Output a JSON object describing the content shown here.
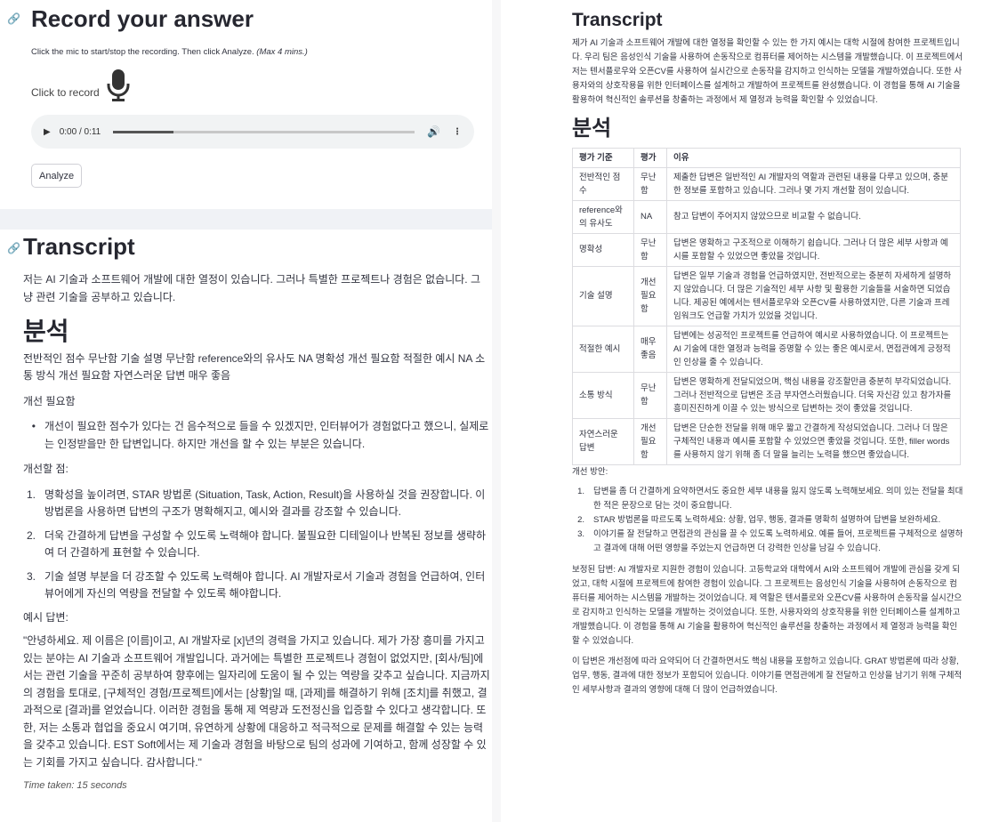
{
  "record": {
    "title": "Record your answer",
    "instructions": "Click the mic to start/stop the recording. Then click Analyze.",
    "max_note": "(Max 4 mins.)",
    "click_to_record": "Click to record",
    "audio_time": "0:00 / 0:11",
    "audio_progress": 0.2,
    "analyze_label": "Analyze"
  },
  "left": {
    "transcript_title": "Transcript",
    "transcript_text": "저는 AI 기술과 소프트웨어 개발에 대한 열정이 있습니다. 그러나 특별한 프로젝트나 경험은 없습니다. 그냥 관련 기술을 공부하고 있습니다.",
    "analysis_title": "분석",
    "summary": "전반적인 점수 무난함 기술 설명 무난함 reference와의 유사도 NA 명확성 개선 필요함 적절한 예시 NA 소통 방식 개선 필요함 자연스러운 답변 매우 좋음",
    "verdict": "개선 필요함",
    "bullet": "개선이 필요한 점수가 있다는 건 음수적으로 들을 수 있겠지만, 인터뷰어가 경험없다고 했으니, 실제로는 인정받을만 한 답변입니다. 하지만 개선을 할 수 있는 부분은 있습니다.",
    "improve_label": "개선할 점:",
    "improvements": [
      "명확성을 높이려면, STAR 방법론 (Situation, Task, Action, Result)을 사용하실 것을 권장합니다. 이 방법론을 사용하면 답변의 구조가 명확해지고, 예시와 결과를 강조할 수 있습니다.",
      "더욱 간결하게 답변을 구성할 수 있도록 노력해야 합니다. 불필요한 디테일이나 반복된 정보를 생략하여 더 간결하게 표현할 수 있습니다.",
      "기술 설명 부분을 더 강조할 수 있도록 노력해야 합니다. AI 개발자로서 기술과 경험을 언급하여, 인터뷰어에게 자신의 역량을 전달할 수 있도록 해야합니다."
    ],
    "example_label": "예시 답변:",
    "example": "\"안녕하세요. 제 이름은 [이름]이고, AI 개발자로 [x]년의 경력을 가지고 있습니다. 제가 가장 흥미를 가지고 있는 분야는 AI 기술과 소프트웨어 개발입니다. 과거에는 특별한 프로젝트나 경험이 없었지만, [회사/팀]에서는 관련 기술을 꾸준히 공부하여 향후에는 일자리에 도움이 될 수 있는 역량을 갖추고 싶습니다. 지금까지의 경험을 토대로, [구체적인 경험/프로젝트]에서는 [상황]일 때, [과제]를 해결하기 위해 [조치]를 취했고, 결과적으로 [결과]를 얻었습니다. 이러한 경험을 통해 제 역량과 도전정신을 입증할 수 있다고 생각합니다. 또한, 저는 소통과 협업을 중요시 여기며, 유연하게 상황에 대응하고 적극적으로 문제를 해결할 수 있는 능력을 갖추고 있습니다. EST Soft에서는 제 기술과 경험을 바탕으로 팀의 성과에 기여하고, 함께 성장할 수 있는 기회를 가지고 싶습니다. 감사합니다.\"",
    "time_taken": "Time taken: 15 seconds"
  },
  "right": {
    "transcript_title": "Transcript",
    "transcript_text": "제가 AI 기술과 소프트웨어 개발에 대한 열정을 확인할 수 있는 한 가지 예시는 대학 시절에 참여한 프로젝트입니다. 우리 팀은 음성인식 기술을 사용하여 손동작으로 컴퓨터를 제어하는 시스템을 개발했습니다. 이 프로젝트에서 저는 텐서플로우와 오픈CV를 사용하여 실시간으로 손동작을 감지하고 인식하는 모델을 개발하였습니다. 또한 사용자와의 상호작용을 위한 인터페이스를 설계하고 개발하여 프로젝트를 완성했습니다. 이 경험을 통해 AI 기술을 활용하여 혁신적인 솔루션을 창출하는 과정에서 제 열정과 능력을 확인할 수 있었습니다.",
    "analysis_title": "분석",
    "table": {
      "headers": [
        "평가 기준",
        "평가",
        "이유"
      ],
      "rows": [
        [
          "전반적인 점수",
          "무난함",
          "제출한 답변은 일반적인 AI 개발자의 역할과 관련된 내용을 다루고 있으며, 충분한 정보를 포함하고 있습니다. 그러나 몇 가지 개선할 점이 있습니다."
        ],
        [
          "reference와의 유사도",
          "NA",
          "참고 답변이 주어지지 않았으므로 비교할 수 없습니다."
        ],
        [
          "명확성",
          "무난함",
          "답변은 명확하고 구조적으로 이해하기 쉽습니다. 그러나 더 많은 세부 사항과 예시를 포함할 수 있었으면 좋았을 것입니다."
        ],
        [
          "기술 설명",
          "개선 필요함",
          "답변은 일부 기술과 경험을 언급하였지만, 전반적으로는 충분히 자세하게 설명하지 않았습니다. 더 많은 기술적인 세부 사항 및 활용한 기술들을 서술하면 되었습니다. 제공된 예에서는 텐서플로우와 오픈CV를 사용하였지만, 다른 기술과 프레임워크도 언급할 가치가 있었을 것입니다."
        ],
        [
          "적절한 예시",
          "매우 좋음",
          "답변에는 성공적인 프로젝트를 언급하여 예시로 사용하였습니다. 이 프로젝트는 AI 기술에 대한 열정과 능력을 증명할 수 있는 좋은 예시로서, 면접관에게 긍정적인 인상을 줄 수 있습니다."
        ],
        [
          "소통 방식",
          "무난함",
          "답변은 명확하게 전달되었으며, 핵심 내용을 강조할만큼 충분히 부각되었습니다. 그러나 전반적으로 답변은 조금 부자연스러웠습니다. 더욱 자신감 있고 참가자를 흥미진진하게 이끌 수 있는 방식으로 답변하는 것이 좋았을 것입니다."
        ],
        [
          "자연스러운 답변",
          "개선 필요함",
          "답변은 단순한 전달을 위해 매우 짧고 간결하게 작성되었습니다. 그러나 더 많은 구체적인 내용과 예시를 포함할 수 있었으면 좋았을 것입니다. 또한, filler words를 사용하지 않기 위해 좀 더 말을 늘리는 노력을 했으면 좋았습니다."
        ]
      ]
    },
    "plan_label": "개선 방안:",
    "plans": [
      "답변을 좀 더 간결하게 요약하면서도 중요한 세부 내용을 잃지 않도록 노력해보세요. 의미 있는 전달을 최대한 적은 문장으로 담는 것이 중요합니다.",
      "STAR 방법론을 따르도록 노력하세요: 상황, 업무, 행동, 결과를 명확히 설명하여 답변을 보완하세요.",
      "이야기를 잘 전달하고 면접관의 관심을 끌 수 있도록 노력하세요. 예를 들어, 프로젝트를 구체적으로 설명하고 결과에 대해 어떤 영향을 주었는지 언급하면 더 강력한 인상을 남길 수 있습니다."
    ],
    "revised": "보정된 답변: AI 개발자로 지원한 경험이 있습니다. 고등학교와 대학에서 AI와 소프트웨어 개발에 관심을 갖게 되었고, 대학 시절에 프로젝트에 참여한 경험이 있습니다. 그 프로젝트는 음성인식 기술을 사용하여 손동작으로 컴퓨터를 제어하는 시스템을 개발하는 것이었습니다. 제 역할은 텐서플로와 오픈CV를 사용하여 손동작을 실시간으로 감지하고 인식하는 모델을 개발하는 것이었습니다. 또한, 사용자와의 상호작용을 위한 인터페이스를 설계하고 개발했습니다. 이 경험을 통해 AI 기술을 활용하여 혁신적인 솔루션을 창출하는 과정에서 제 열정과 능력을 확인할 수 있었습니다.",
    "closing": "이 답변은 개선점에 따라 요약되어 더 간결하면서도 핵심 내용을 포함하고 있습니다. GRAT 방법론에 따라 상황, 업무, 행동, 결과에 대한 정보가 포함되어 있습니다. 이야기를 면접관에게 잘 전달하고 인상을 남기기 위해 구체적인 세부사항과 결과의 영향에 대해 더 많이 언급하였습니다."
  }
}
